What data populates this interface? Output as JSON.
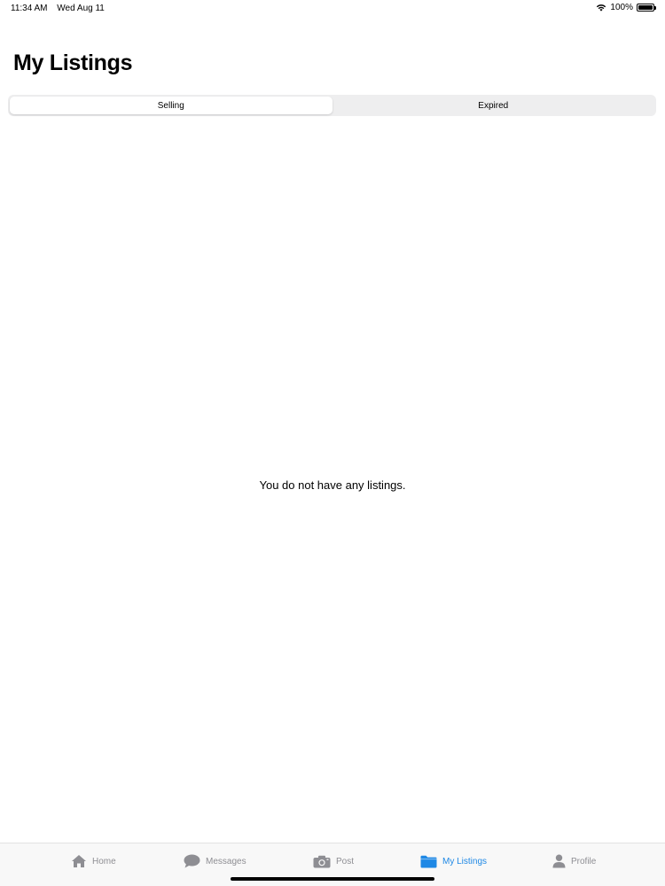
{
  "status_bar": {
    "time": "11:34 AM",
    "date": "Wed Aug 11",
    "battery": "100%"
  },
  "page": {
    "title": "My Listings"
  },
  "segments": {
    "selling": "Selling",
    "expired": "Expired",
    "selected": "selling"
  },
  "empty_state": {
    "message": "You do not have any listings."
  },
  "tab_bar": {
    "active": "my_listings",
    "accent_color": "#1e88e5",
    "inactive_color": "#8e8e93",
    "items": [
      {
        "id": "home",
        "label": "Home",
        "icon": "house-icon"
      },
      {
        "id": "messages",
        "label": "Messages",
        "icon": "chat-bubble-icon"
      },
      {
        "id": "post",
        "label": "Post",
        "icon": "camera-icon"
      },
      {
        "id": "my_listings",
        "label": "My Listings",
        "icon": "folder-icon"
      },
      {
        "id": "profile",
        "label": "Profile",
        "icon": "person-icon"
      }
    ]
  }
}
